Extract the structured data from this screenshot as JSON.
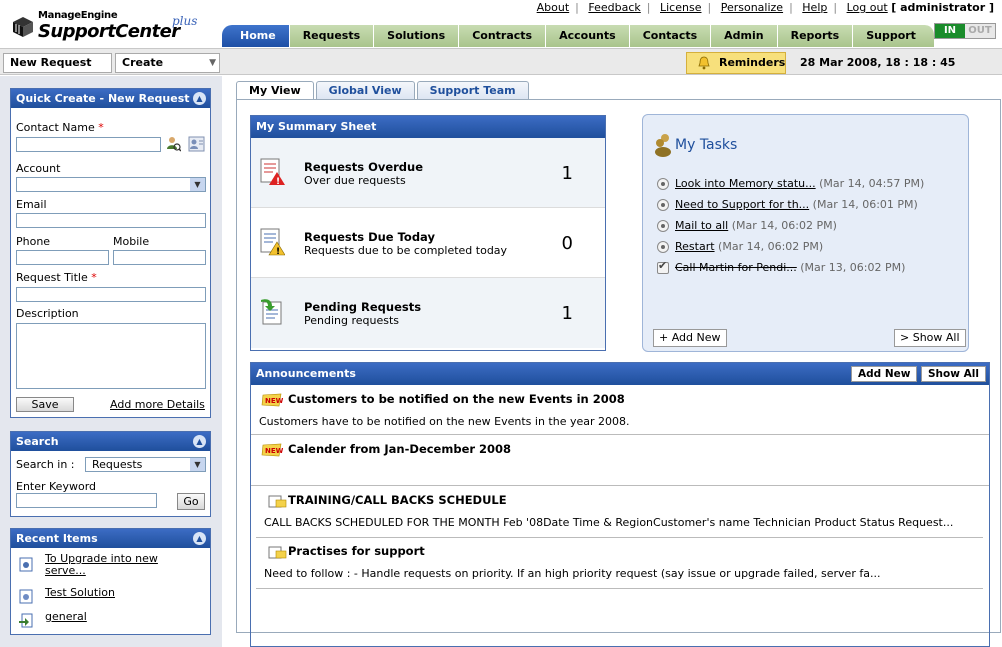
{
  "brand": {
    "small": "ManageEngine",
    "big": "SupportCenter",
    "plus": "plus"
  },
  "toplinks": {
    "about": "About",
    "feedback": "Feedback",
    "license": "License",
    "personalize": "Personalize",
    "help": "Help",
    "logout": "Log out",
    "user": "[ administrator ]"
  },
  "tabs": [
    {
      "label": "Home"
    },
    {
      "label": "Requests"
    },
    {
      "label": "Solutions"
    },
    {
      "label": "Contracts"
    },
    {
      "label": "Accounts"
    },
    {
      "label": "Contacts"
    },
    {
      "label": "Admin"
    },
    {
      "label": "Reports"
    },
    {
      "label": "Support"
    }
  ],
  "inout": {
    "in": "IN",
    "out": "OUT"
  },
  "subbar": {
    "new_request": "New Request",
    "create": "Create",
    "reminders": "Reminders",
    "datetime": "28 Mar 2008, 18 : 18 : 45"
  },
  "quick_create": {
    "title": "Quick Create - New Request",
    "contact_name": "Contact Name",
    "account": "Account",
    "email": "Email",
    "phone": "Phone",
    "mobile": "Mobile",
    "request_title": "Request Title",
    "description": "Description",
    "save": "Save",
    "more": "Add more Details"
  },
  "search": {
    "title": "Search",
    "search_in": "Search in :",
    "selected": "Requests",
    "keyword": "Enter Keyword",
    "go": "Go"
  },
  "recent": {
    "title": "Recent Items",
    "items": [
      "To Upgrade into new serve...",
      "Test Solution",
      "general"
    ]
  },
  "subtabs": [
    "My View",
    "Global View",
    "Support Team"
  ],
  "summary": {
    "title": "My Summary Sheet",
    "rows": [
      {
        "title": "Requests Overdue",
        "sub": "Over due requests",
        "count": "1"
      },
      {
        "title": "Requests Due Today",
        "sub": "Requests due to be completed today",
        "count": "0"
      },
      {
        "title": "Pending Requests",
        "sub": "Pending requests",
        "count": "1"
      }
    ]
  },
  "tasks": {
    "title": "My Tasks",
    "items": [
      {
        "name": "Look into Memory statu...",
        "date": "(Mar 14, 04:57 PM)"
      },
      {
        "name": "Need to Support for th...",
        "date": "(Mar 14, 06:01 PM)"
      },
      {
        "name": "Mail to all",
        "date": "(Mar 14, 06:02 PM)"
      },
      {
        "name": "Restart",
        "date": "(Mar 14, 06:02 PM)"
      },
      {
        "name": "Call Martin for Pendi...",
        "date": "(Mar 13, 06:02 PM)"
      }
    ],
    "add_new": "+ Add New",
    "show_all": "> Show All"
  },
  "announcements": {
    "title": "Announcements",
    "add_new": "Add New",
    "show_all": "Show All",
    "items": [
      {
        "title": "Customers to be notified on the new Events in 2008",
        "body": "Customers have to be notified on the new Events in the year 2008."
      },
      {
        "title": "Calender from Jan-December 2008",
        "body": ""
      },
      {
        "title": "TRAINING/CALL BACKS SCHEDULE",
        "body": "CALL BACKS SCHEDULED FOR THE MONTH Feb '08Date Time & RegionCustomer's name Technician Product Status Request..."
      },
      {
        "title": "Practises for support",
        "body": "Need to follow : - Handle requests on priority. If an high priority request (say issue or upgrade failed, server fa..."
      }
    ]
  }
}
